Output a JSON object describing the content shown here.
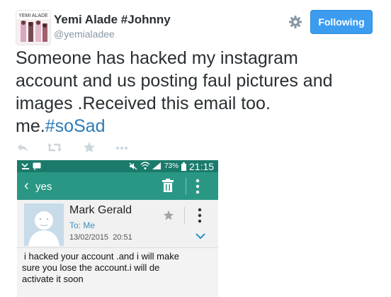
{
  "author": {
    "name": "Yemi Alade #Johnny",
    "handle": "@yemialadee",
    "avatar_text": "YEMI ALADE"
  },
  "follow_button": {
    "label": "Following",
    "color": "#3b9cf0"
  },
  "tweet": {
    "text_line1": "Someone has hacked my instagram",
    "text_line2": "account and us posting faul  pictures and",
    "text_line3": "images .Received this email too.",
    "text_line4_prefix": "me.",
    "hashtag": "#soSad",
    "hashtag_color": "#2b7bb9"
  },
  "actions": {
    "icons": [
      "reply-icon",
      "retweet-icon",
      "favorite-icon",
      "more-icon"
    ]
  },
  "phone": {
    "status": {
      "battery": "73%",
      "time": "21:15"
    },
    "appbar": {
      "subject": "yes",
      "color": "#2a9785"
    },
    "email": {
      "sender": "Mark Gerald",
      "to": "To: Me",
      "date": "13/02/2015",
      "time": "20:51",
      "body_line1": "i hacked your account .and i will make",
      "body_line2": "sure you lose the account.i will de",
      "body_line3": "activate it soon"
    }
  }
}
